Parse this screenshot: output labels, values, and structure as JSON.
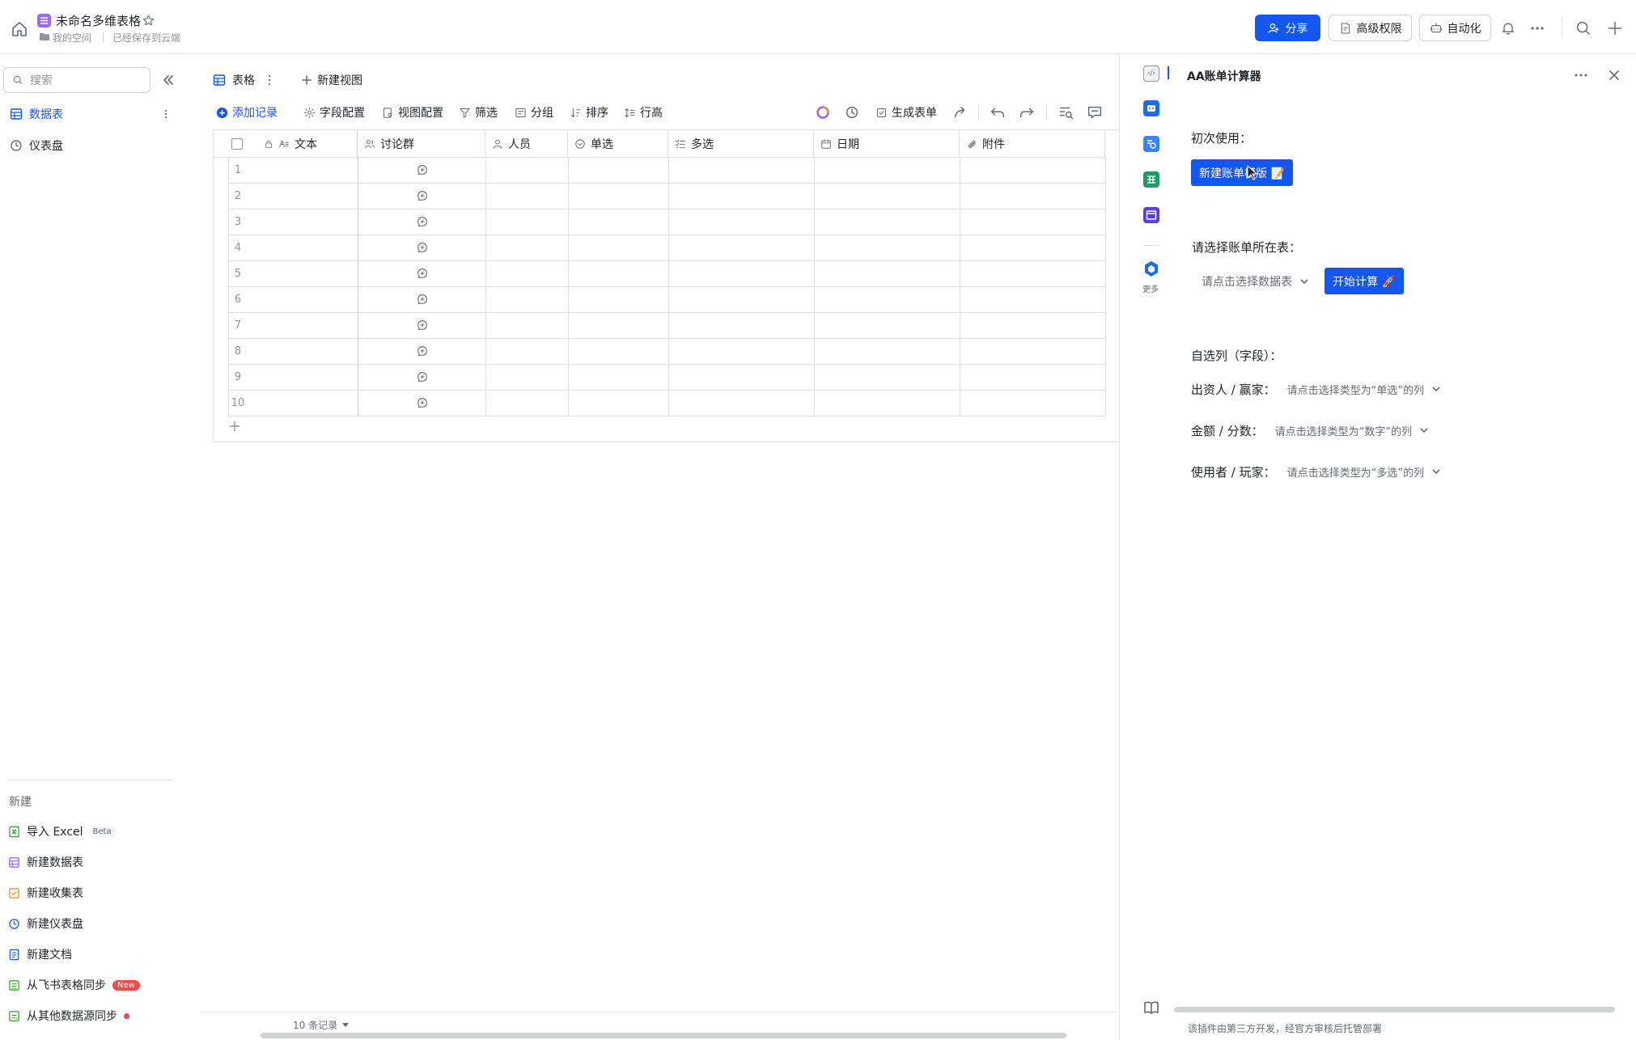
{
  "doc": {
    "title": "未命名多维表格",
    "space": "我的空间",
    "save_status": "已经保存到云端"
  },
  "top_actions": {
    "share": "分享",
    "permissions": "高级权限",
    "automation": "自动化"
  },
  "sidebar": {
    "search_placeholder": "搜索",
    "tables": [
      {
        "label": "数据表"
      },
      {
        "label": "仪表盘"
      }
    ],
    "new_section_label": "新建",
    "new_items": [
      {
        "label": "导入 Excel",
        "badge": "Beta"
      },
      {
        "label": "新建数据表"
      },
      {
        "label": "新建收集表"
      },
      {
        "label": "新建仪表盘"
      },
      {
        "label": "新建文档"
      },
      {
        "label": "从飞书表格同步",
        "badge": "New"
      },
      {
        "label": "从其他数据源同步"
      }
    ]
  },
  "view": {
    "tab_label": "表格",
    "new_view_label": "新建视图"
  },
  "toolbar": {
    "add_record": "添加记录",
    "field_config": "字段配置",
    "view_config": "视图配置",
    "filter": "筛选",
    "group": "分组",
    "sort": "排序",
    "row_height": "行高",
    "generate_form": "生成表单"
  },
  "grid": {
    "columns": [
      "文本",
      "讨论群",
      "人员",
      "单选",
      "多选",
      "日期",
      "附件"
    ],
    "rows": [
      "1",
      "2",
      "3",
      "4",
      "5",
      "6",
      "7",
      "8",
      "9",
      "10"
    ],
    "record_count": "10 条记录"
  },
  "plugin": {
    "rail_more_label": "更多",
    "title": "AA账单计算器",
    "first_use_label": "初次使用：",
    "new_template_button": "新建账单模版 📝",
    "select_table_label": "请选择账单所在表：",
    "table_select_placeholder": "请点击选择数据表",
    "start_button": "开始计算 🚀",
    "custom_columns_label": "自选列（字段）：",
    "fields": [
      {
        "label": "出资人 / 赢家：",
        "placeholder": "请点击选择类型为“单选”的列"
      },
      {
        "label": "金额 / 分数：",
        "placeholder": "请点击选择类型为“数字”的列"
      },
      {
        "label": "使用者 / 玩家：",
        "placeholder": "请点击选择类型为“多选”的列"
      }
    ],
    "footer_note": "该插件由第三方开发，经官方审核后托管部署"
  },
  "colors": {
    "accent": "#1456f0",
    "doc_badge": "#9b6cf0",
    "danger": "#f54a45"
  }
}
